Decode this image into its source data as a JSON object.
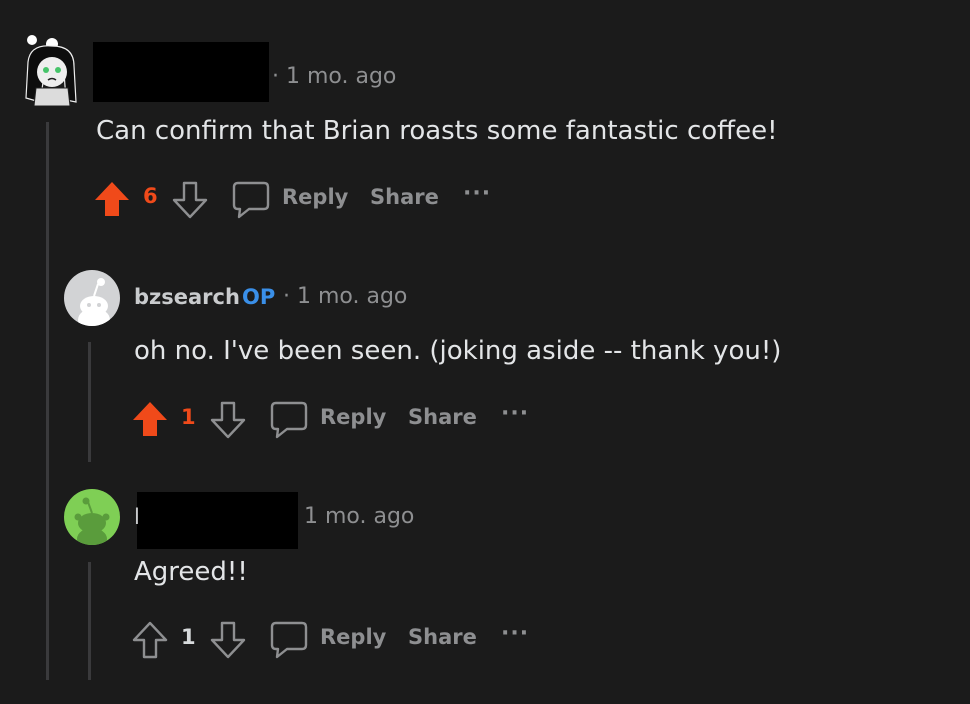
{
  "colors": {
    "upvote_active": "#f04a1a",
    "op_badge": "#3a8fe8",
    "muted": "#8e8f91"
  },
  "comments": [
    {
      "username": "",
      "time": "· 1 mo. ago",
      "text": "Can confirm that Brian roasts some fantastic coffee!",
      "score": "6",
      "upvoted": true,
      "reply_label": "Reply",
      "share_label": "Share",
      "more_label": "···"
    },
    {
      "username": "bzsearch",
      "op_badge": "OP",
      "time": "· 1 mo. ago",
      "text": "oh no. I've been seen. (joking aside -- thank you!)",
      "score": "1",
      "upvoted": true,
      "reply_label": "Reply",
      "share_label": "Share",
      "more_label": "···"
    },
    {
      "username": "l",
      "time": "1 mo. ago",
      "text": "Agreed!!",
      "score": "1",
      "upvoted": false,
      "reply_label": "Reply",
      "share_label": "Share",
      "more_label": "···"
    }
  ]
}
